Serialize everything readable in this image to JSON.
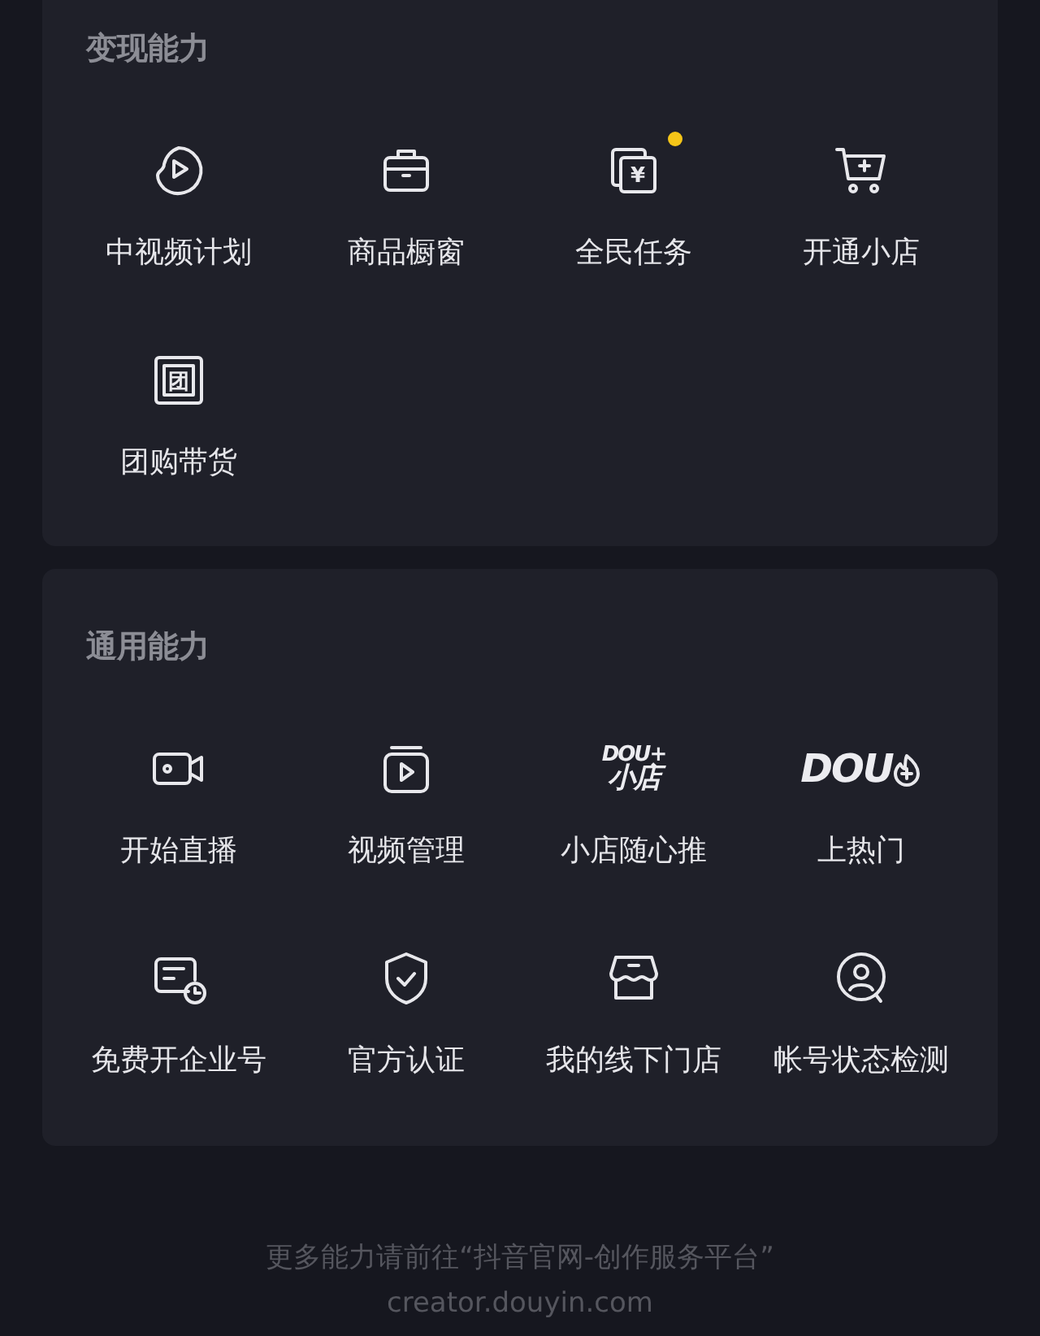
{
  "sections": [
    {
      "title": "变现能力",
      "items": [
        {
          "kind": "icon",
          "label": "中视频计划",
          "dot": false
        },
        {
          "kind": "icon",
          "label": "商品橱窗",
          "dot": false
        },
        {
          "kind": "icon",
          "label": "全民任务",
          "dot": true,
          "glyph": "¥"
        },
        {
          "kind": "icon",
          "label": "开通小店",
          "dot": false
        },
        {
          "kind": "icon",
          "label": "团购带货",
          "dot": false,
          "glyph": "团"
        }
      ]
    },
    {
      "title": "通用能力",
      "items": [
        {
          "kind": "icon",
          "label": "开始直播",
          "dot": false
        },
        {
          "kind": "icon",
          "label": "视频管理",
          "dot": false
        },
        {
          "kind": "logo",
          "label": "小店随心推",
          "dot": false,
          "logo": [
            "DOU+",
            "小店"
          ]
        },
        {
          "kind": "logo",
          "label": "上热门",
          "dot": false,
          "logo": [
            "DOU"
          ]
        },
        {
          "kind": "icon",
          "label": "免费开企业号",
          "dot": false
        },
        {
          "kind": "icon",
          "label": "官方认证",
          "dot": false
        },
        {
          "kind": "icon",
          "label": "我的线下门店",
          "dot": false
        },
        {
          "kind": "icon",
          "label": "帐号状态检测",
          "dot": false
        }
      ]
    }
  ],
  "footer": {
    "note": "更多能力请前往“抖音官网-创作服务平台”",
    "url": "creator.douyin.com"
  }
}
